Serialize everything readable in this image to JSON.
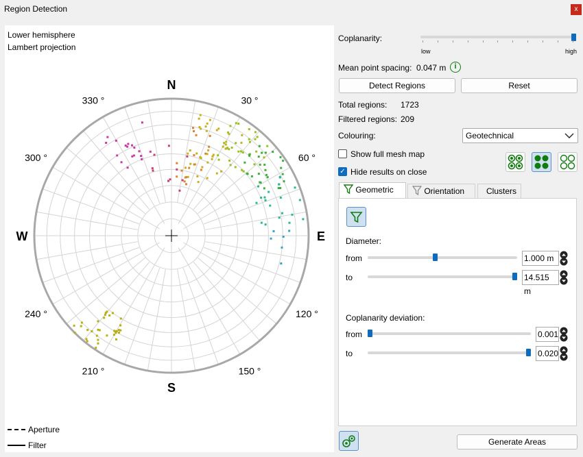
{
  "window": {
    "title": "Region Detection",
    "close_glyph": "x"
  },
  "plot": {
    "label_line1": "Lower hemisphere",
    "label_line2": "Lambert projection",
    "compass": {
      "N": "N",
      "E": "E",
      "S": "S",
      "W": "W"
    },
    "azimuth_labels": [
      {
        "deg": 30,
        "text": "30 °"
      },
      {
        "deg": 60,
        "text": "60 °"
      },
      {
        "deg": 120,
        "text": "120 °"
      },
      {
        "deg": 150,
        "text": "150 °"
      },
      {
        "deg": 210,
        "text": "210 °"
      },
      {
        "deg": 240,
        "text": "240 °"
      },
      {
        "deg": 300,
        "text": "300 °"
      },
      {
        "deg": 330,
        "text": "330 °"
      }
    ],
    "legend": {
      "aperture": "Aperture",
      "filter": "Filter"
    }
  },
  "controls": {
    "coplanarity_label": "Coplanarity:",
    "coplanarity_low": "low",
    "coplanarity_high": "high",
    "coplanarity_level": 1.0,
    "mean_spacing_label": "Mean point spacing:",
    "mean_spacing_value": "0.047 m",
    "info_glyph": "i",
    "detect_button": "Detect Regions",
    "reset_button": "Reset",
    "total_label": "Total regions:",
    "total_value": "1723",
    "filtered_label": "Filtered regions:",
    "filtered_value": "209",
    "colouring_label": "Colouring:",
    "colouring_value": "Geotechnical",
    "show_mesh_label": "Show full mesh map",
    "show_mesh_checked": false,
    "hide_results_label": "Hide results on close",
    "hide_results_checked": true,
    "checkmark": "✓"
  },
  "tabs": [
    {
      "label": "Geometric",
      "icon": "funnel-icon"
    },
    {
      "label": "Orientation",
      "icon": "funnel-outline-icon"
    },
    {
      "label": "Clusters"
    }
  ],
  "geometric": {
    "diameter_label": "Diameter:",
    "from_label": "from",
    "to_label": "to",
    "diameter_from": "1.000 m",
    "diameter_to": "14.515 m",
    "diameter_from_level": 0.45,
    "diameter_to_level": 1.0,
    "coplanarity_dev_label": "Coplanarity deviation:",
    "dev_from": "0.001",
    "dev_to": "0.020",
    "dev_from_level": 0.0,
    "dev_to_level": 1.0
  },
  "footer": {
    "generate_button": "Generate Areas"
  },
  "colors": {
    "accent": "#0f6cbd",
    "green": "#107c10",
    "close": "#c42b1c"
  }
}
